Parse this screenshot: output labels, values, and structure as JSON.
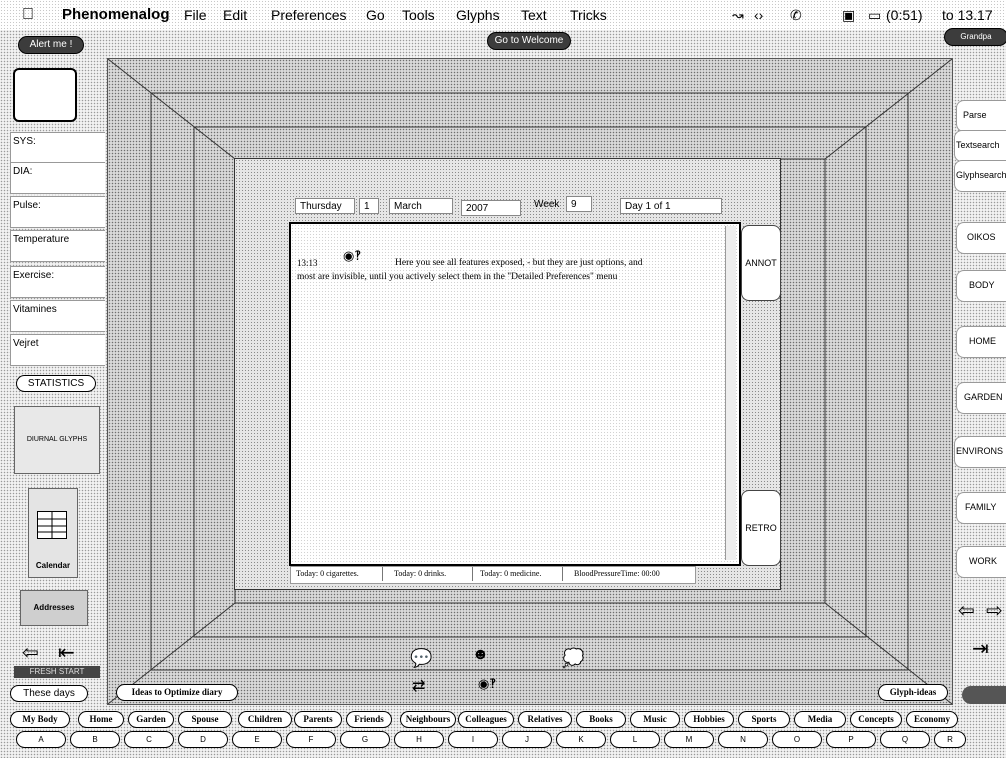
{
  "menubar": {
    "app_name": "Phenomenalog",
    "items": [
      "File",
      "Edit",
      "Preferences",
      "Go",
      "Tools",
      "Glyphs",
      "Text",
      "Tricks"
    ],
    "battery": "(0:51)",
    "time": "to 13.17"
  },
  "top": {
    "alert_button": "Alert me !",
    "welcome_button": "Go to Welcome",
    "right_dark_button": "Grandpa"
  },
  "left_panel": {
    "fields": [
      "SYS:",
      "DIA:",
      "Pulse:",
      "Temperature",
      "Exercise:",
      "Vitamines",
      "Vejret"
    ],
    "statistics_button": "STATISTICS",
    "diurnal_glyphs": "DIURNAL GLYPHS",
    "calendar_label": "Calendar",
    "addresses_label": "Addresses",
    "dark_label": "FRESH START"
  },
  "right_panel": {
    "top_buttons": [
      "Parse",
      "Textsearch",
      "Glyphsearch"
    ],
    "categories": [
      "OIKOS",
      "BODY",
      "HOME",
      "GARDEN",
      "ENVIRONS",
      "FAMILY",
      "WORK"
    ]
  },
  "diary": {
    "weekday": "Thursday",
    "day": "1",
    "month": "March",
    "year": "2007",
    "week_label": "Week",
    "week": "9",
    "day_of": "Day 1 of 1",
    "time": "13:13",
    "text_line1": "Here you see all features exposed, - but they are just options, and",
    "text_line2": "most are invisible, until you actively select them in the \"Detailed Preferences\" menu",
    "annot_button": "ANNOT",
    "retro_button": "RETRO",
    "footer": [
      "Today: 0 cigarettes.",
      "Today: 0 drinks.",
      "Today: 0 medicine.",
      "BloodPressureTime: 00:00"
    ]
  },
  "bottom": {
    "these_days": "These days",
    "ideas": "Ideas to Optimize diary",
    "glyph_ideas": "Glyph-ideas",
    "topics": [
      "My Body",
      "Home",
      "Garden",
      "Spouse",
      "Children",
      "Parents",
      "Friends",
      "Neighbours",
      "Colleagues",
      "Relatives",
      "Books",
      "Music",
      "Hobbies",
      "Sports",
      "Media",
      "Concepts",
      "Economy"
    ],
    "letters": [
      "A",
      "B",
      "C",
      "D",
      "E",
      "F",
      "G",
      "H",
      "I",
      "J",
      "K",
      "L",
      "M",
      "N",
      "O",
      "P",
      "Q",
      "R"
    ]
  }
}
